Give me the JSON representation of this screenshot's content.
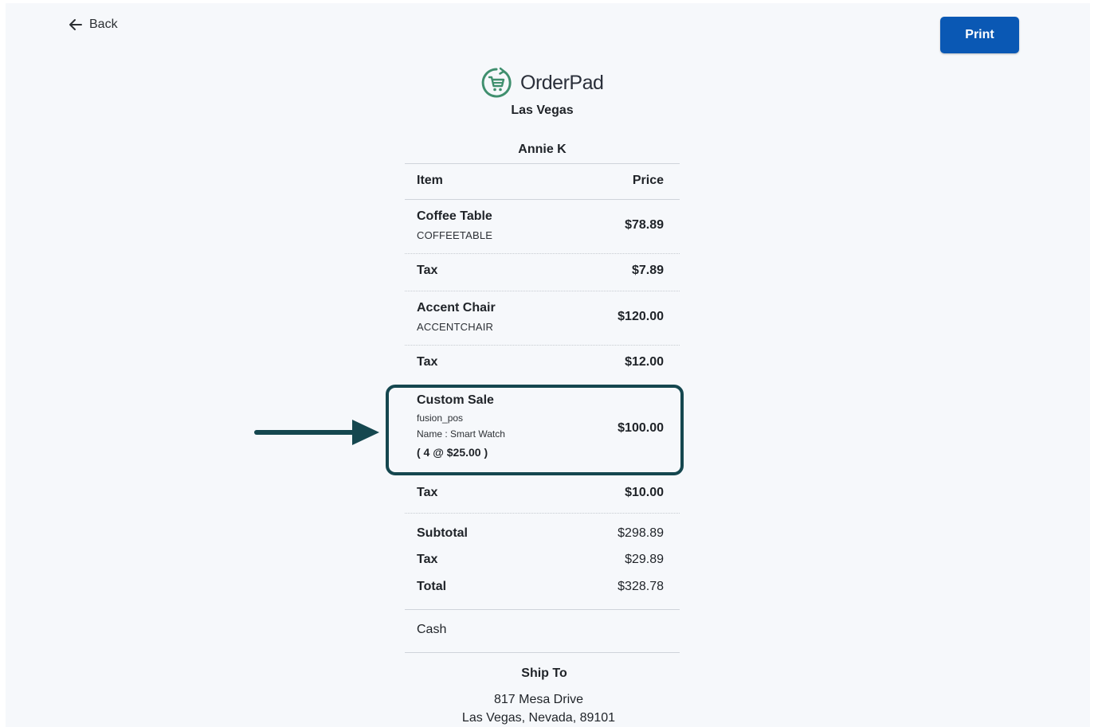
{
  "nav": {
    "back_label": "Back",
    "print_label": "Print"
  },
  "brand": {
    "name": "OrderPad",
    "location": "Las Vegas"
  },
  "customer": {
    "name": "Annie K"
  },
  "table": {
    "header": {
      "item": "Item",
      "price": "Price"
    },
    "rows": [
      {
        "name": "Coffee Table",
        "sku": "COFFEETABLE",
        "price": "$78.89"
      },
      {
        "tax_label": "Tax",
        "price": "$7.89"
      },
      {
        "name": "Accent Chair",
        "sku": "ACCENTCHAIR",
        "price": "$120.00"
      },
      {
        "tax_label": "Tax",
        "price": "$12.00"
      },
      {
        "name": "Custom Sale",
        "sku": "fusion_pos",
        "detail": "Name : Smart Watch",
        "qty": "( 4 @ $25.00 )",
        "price": "$100.00"
      },
      {
        "tax_label": "Tax",
        "price": "$10.00"
      }
    ]
  },
  "totals": {
    "subtotal_label": "Subtotal",
    "subtotal": "$298.89",
    "tax_label": "Tax",
    "tax": "$29.89",
    "total_label": "Total",
    "total": "$328.78"
  },
  "payment": {
    "method": "Cash"
  },
  "shipping": {
    "title": "Ship To",
    "line1": "817 Mesa Drive",
    "line2": "Las Vegas, Nevada, 89101"
  },
  "colors": {
    "print_button": "#0a58b4",
    "highlight": "#15474f",
    "logo": "#3f8f6e"
  }
}
